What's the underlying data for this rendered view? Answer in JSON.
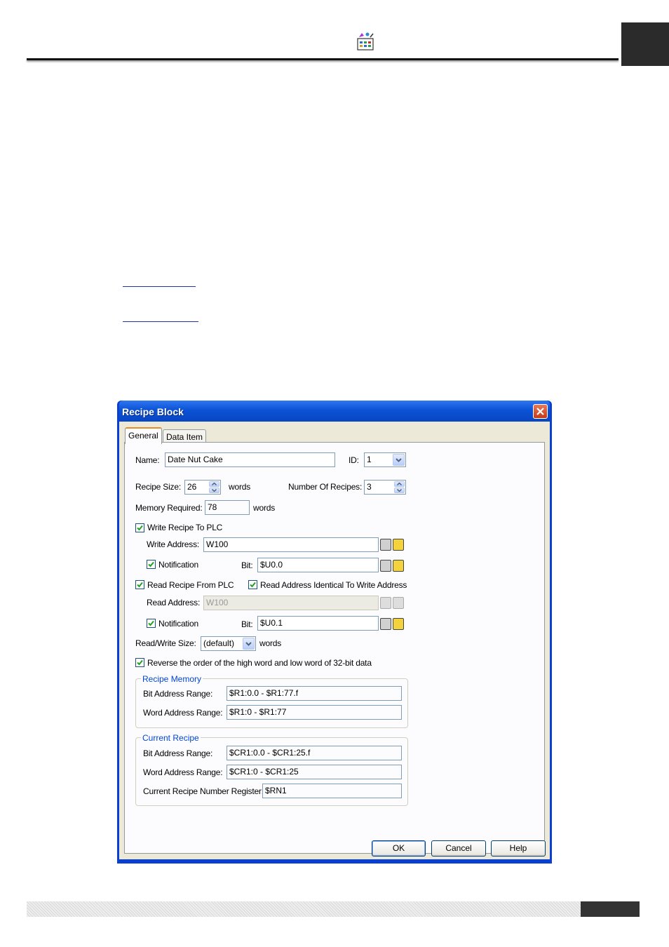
{
  "dialog": {
    "title": "Recipe Block",
    "tabs": [
      {
        "label": "General"
      },
      {
        "label": "Data Item"
      }
    ],
    "general": {
      "name_label": "Name:",
      "name_value": "Date Nut Cake",
      "id_label": "ID:",
      "id_value": "1",
      "recipe_size_label": "Recipe Size:",
      "recipe_size_value": "26",
      "words1": "words",
      "number_of_recipes_label": "Number Of Recipes:",
      "number_of_recipes_value": "3",
      "memory_required_label": "Memory Required:",
      "memory_required_value": "78",
      "words2": "words",
      "write_recipe_label": "Write Recipe To PLC",
      "write_address_label": "Write Address:",
      "write_address_value": "W100",
      "notification_label": "Notification",
      "bit_label": "Bit:",
      "write_bit_value": "$U0.0",
      "read_recipe_label": "Read Recipe From PLC",
      "read_identical_label": "Read Address Identical To Write Address",
      "read_address_label": "Read Address:",
      "read_address_value": "W100",
      "read_bit_value": "$U0.1",
      "rw_size_label": "Read/Write Size:",
      "rw_size_value": "(default)",
      "words3": "words",
      "reverse_label": "Reverse the order of the high word and low word of 32-bit data"
    },
    "recipe_memory": {
      "title": "Recipe Memory",
      "bit_range_label": "Bit Address Range:",
      "bit_range_value": "$R1:0.0 - $R1:77.f",
      "word_range_label": "Word Address Range:",
      "word_range_value": "$R1:0 - $R1:77"
    },
    "current_recipe": {
      "title": "Current Recipe",
      "bit_range_label": "Bit Address Range:",
      "bit_range_value": "$CR1:0.0 - $CR1:25.f",
      "word_range_label": "Word Address Range:",
      "word_range_value": "$CR1:0 - $CR1:25",
      "number_register_label": "Current Recipe Number Register:",
      "number_register_value": "$RN1"
    },
    "buttons": {
      "ok": "OK",
      "cancel": "Cancel",
      "help": "Help"
    }
  }
}
